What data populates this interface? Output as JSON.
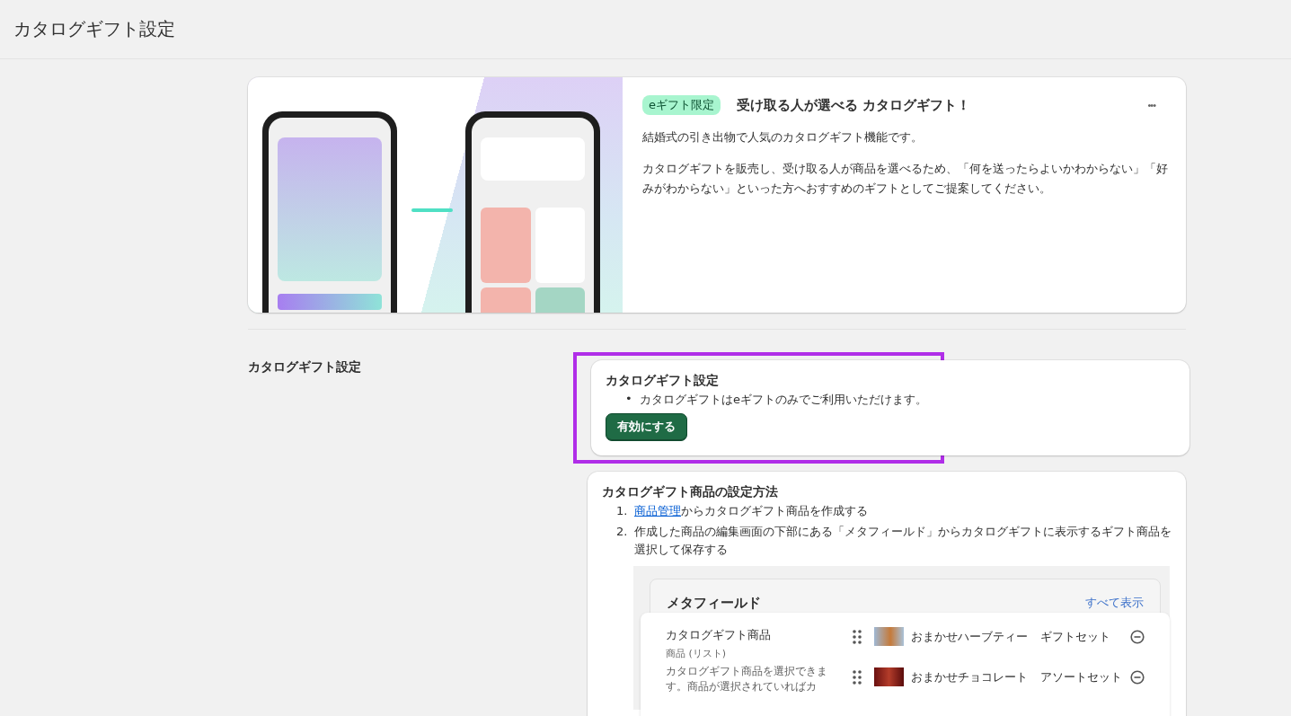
{
  "page": {
    "title": "カタログギフト設定"
  },
  "hero": {
    "badge": "eギフト限定",
    "title": "受け取る人が選べる カタログギフト！",
    "menu": "•••",
    "paragraphs": [
      "結婚式の引き出物で人気のカタログギフト機能です。",
      "カタログギフトを販売し、受け取る人が商品を選べるため、「何を送ったらよいかわからない」「好みがわからない」といった方へおすすめのギフトとしてご提案してください。"
    ]
  },
  "section": {
    "label": "カタログギフト設定"
  },
  "settings_card": {
    "title": "カタログギフト設定",
    "bullets": [
      {
        "marker": "•",
        "text": "カタログギフトはeギフトのみでご利用いただけます。"
      }
    ],
    "button": "有効にする",
    "highlighted": true
  },
  "howto_card": {
    "title": "カタログギフト商品の設定方法",
    "steps": [
      {
        "number": "1.",
        "link": "商品管理",
        "text": "からカタログギフト商品を作成する"
      },
      {
        "number": "2.",
        "text": "作成した商品の編集画面の下部にある「メタフィールド」からカタログギフトに表示するギフト商品を選択して保存する"
      }
    ],
    "metafield": {
      "title": "メタフィールド",
      "view_all": "すべて表示",
      "field_name": "カタログギフト商品",
      "field_type": "商品 (リスト)",
      "field_help": "カタログギフト商品を選択できます。商品が選択されていればカ",
      "items": [
        {
          "name": "おまかせハーブティー",
          "variant": "ギフトセット",
          "kind": "tea"
        },
        {
          "name": "おまかせチョコレート",
          "variant": "アソートセット",
          "kind": "chocolate"
        }
      ]
    }
  }
}
